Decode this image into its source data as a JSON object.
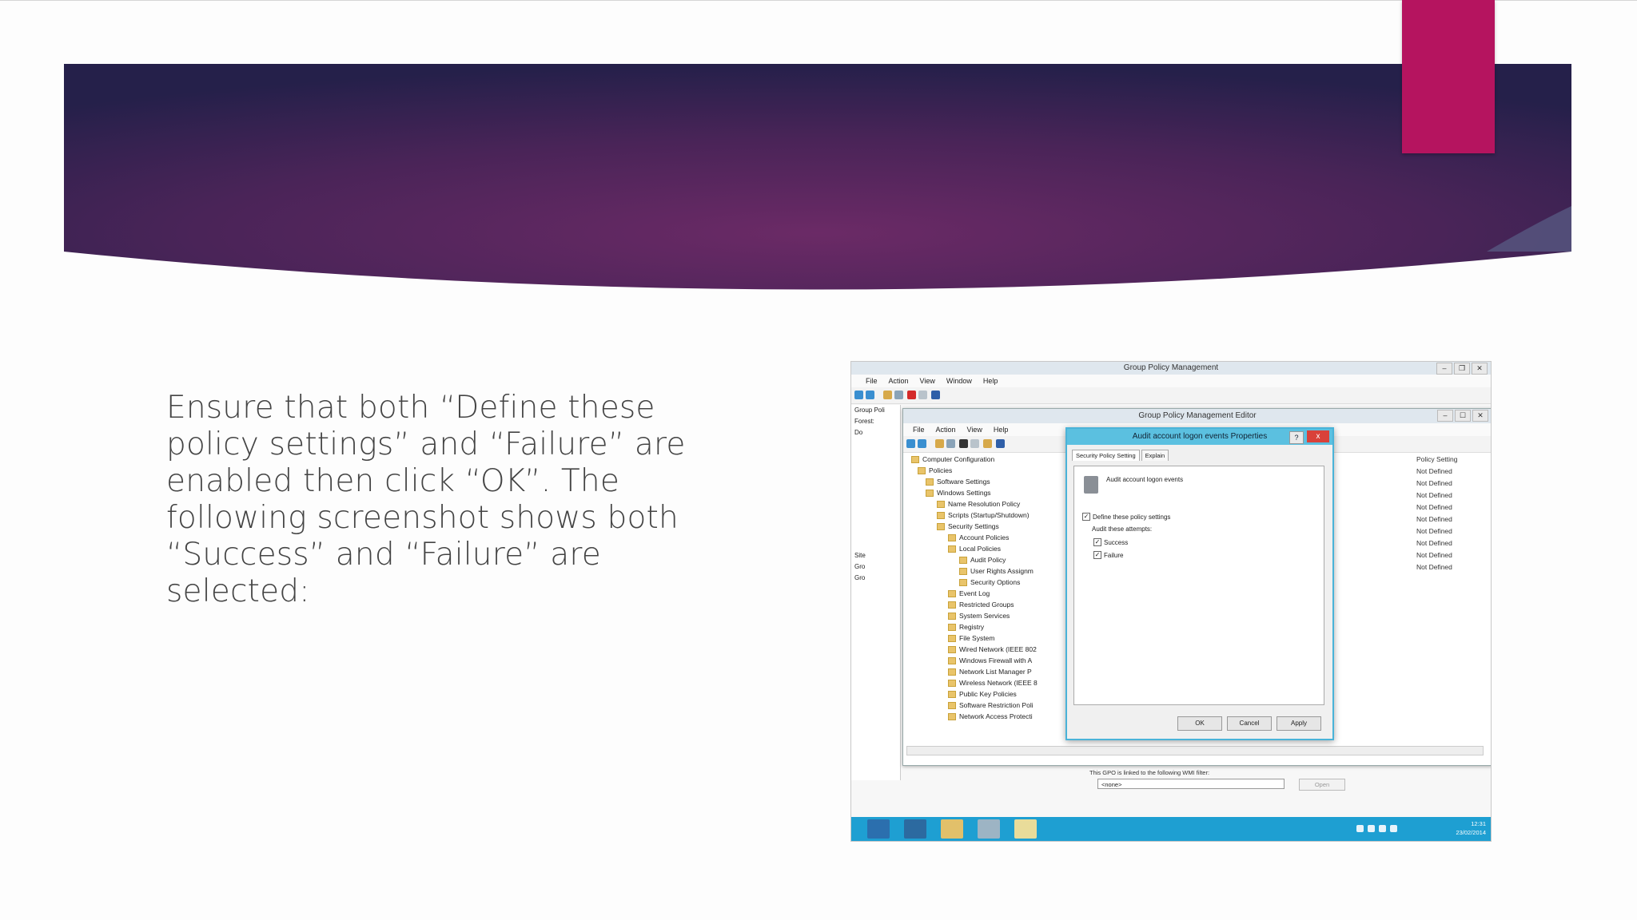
{
  "slide": {
    "body_text": "Ensure that both “Define these policy settings” and “Failure” are enabled then click “OK”. The following screenshot shows both “Success” and “Failure” are selected:"
  },
  "screenshot": {
    "outer_title": "Group Policy Management",
    "outer_menu": [
      "File",
      "Action",
      "View",
      "Window",
      "Help"
    ],
    "left_tree": [
      "Group Poli",
      "Forest:",
      "Do",
      "",
      "Site",
      "Gro",
      "Gro"
    ],
    "inner_title": "Group Policy Management Editor",
    "inner_menu": [
      "File",
      "Action",
      "View",
      "Help"
    ],
    "tree": [
      "Computer Configuration",
      "Policies",
      "Software Settings",
      "Windows Settings",
      "Name Resolution Policy",
      "Scripts (Startup/Shutdown)",
      "Security Settings",
      "Account Policies",
      "Local Policies",
      "Audit Policy",
      "User Rights Assignm",
      "Security Options",
      "Event Log",
      "Restricted Groups",
      "System Services",
      "Registry",
      "File System",
      "Wired Network (IEEE 802",
      "Windows Firewall with A",
      "Network List Manager P",
      "Wireless Network (IEEE 8",
      "Public Key Policies",
      "Software Restriction Poli",
      "Network Access Protecti"
    ],
    "right_column_header": "Policy Setting",
    "right_column_values": [
      "Not Defined",
      "Not Defined",
      "Not Defined",
      "Not Defined",
      "Not Defined",
      "Not Defined",
      "Not Defined",
      "Not Defined",
      "Not Defined"
    ],
    "dialog": {
      "title": "Audit account logon events Properties",
      "help": "?",
      "close": "x",
      "tabs": [
        "Security Policy Setting",
        "Explain"
      ],
      "policy_name": "Audit account logon events",
      "define_label": "Define these policy settings",
      "attempts_label": "Audit these attempts:",
      "success_label": "Success",
      "failure_label": "Failure",
      "ok": "OK",
      "cancel": "Cancel",
      "apply": "Apply"
    },
    "wmi_label": "This GPO is linked to the following WMI filter:",
    "wmi_value": "<none>",
    "wmi_open": "Open",
    "clock_time": "12:31",
    "clock_date": "23/02/2014",
    "colors": {
      "taskbar": "#1e9fd2",
      "dialog_title": "#5bc0e0",
      "accent_pink": "#b5145f"
    }
  }
}
